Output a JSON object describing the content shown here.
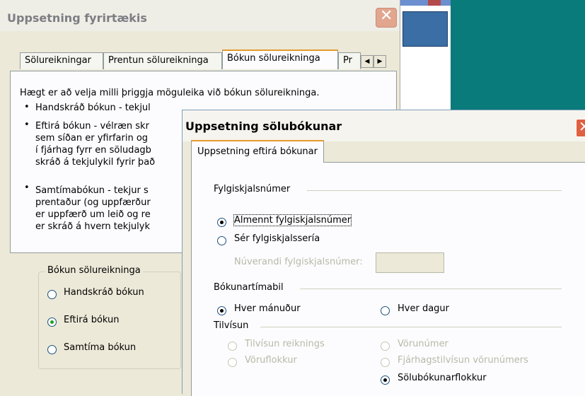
{
  "dialog_main": {
    "title": "Uppsetning fyrirtækis",
    "tabs": [
      "Sölureikningar",
      "Prentun sölureikninga",
      "Bókun sölureikninga",
      "Pr"
    ],
    "intro": "Hægt er að velja milli þriggja möguleika við bókun sölureikninga.",
    "bullets": [
      [
        "Handskráð bókun - tekjul"
      ],
      [
        "Eftirá bókun - vélræn skr",
        "sem síðan er yfirfarin og",
        "í fjárhag fyrr en söludagb",
        "skráð á tekjulykil fyrir það"
      ],
      [
        "Samtímabókun - tekjur s",
        "prentaður (og uppfærður",
        "er uppfærð um leið og re",
        "er skráð á hvern tekjulyk"
      ]
    ],
    "booking_group": {
      "label": "Bókun sölureikninga",
      "options": [
        "Handskráð bókun",
        "Eftirá bókun",
        "Samtíma bókun"
      ],
      "selected": "Eftirá bókun"
    }
  },
  "dialog_sales": {
    "title": "Uppsetning sölubókunar",
    "tab": "Uppsetning eftirá bókunar",
    "voucher_section": {
      "label": "Fylgiskjalsnúmer",
      "options": [
        "Almennt fylgiskjalsnúmer",
        "Sér fylgiskjalssería"
      ],
      "selected": "Almennt fylgiskjalsnúmer",
      "current_label": "Núverandi fylgiskjalsnúmer:",
      "current_value": ""
    },
    "period_section": {
      "label": "Bókunartímabil",
      "options": [
        "Hver mánuður",
        "Hver dagur"
      ],
      "selected": "Hver mánuður"
    },
    "reference_section": {
      "label": "Tilvísun",
      "left_options": [
        "Tilvísun reiknings",
        "Vöruflokkur"
      ],
      "right_options": [
        "Vörunúmer",
        "Fjárhagstilvísun vörunúmers",
        "Sölubókunarflokkur"
      ],
      "selected": "Sölubókunarflokkur"
    }
  },
  "colors": {
    "desktop": "#0a7b7b",
    "tab_highlight": "#e69a2a",
    "radio_green": "#21a121",
    "close_red": "#e06040"
  }
}
